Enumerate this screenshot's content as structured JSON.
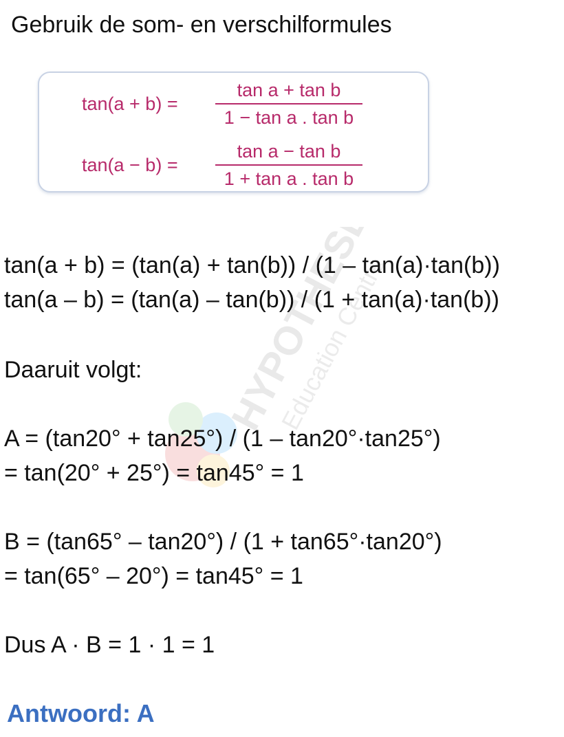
{
  "heading": "Gebruik de som- en verschilformules",
  "formula_box": {
    "row1": {
      "lhs": "tan(a + b) =",
      "numerator": "tan a + tan b",
      "denominator": "1 − tan a . tan b"
    },
    "row2": {
      "lhs": "tan(a − b) =",
      "numerator": "tan a − tan b",
      "denominator": "1 + tan a . tan b"
    },
    "color": "#b72a6a"
  },
  "lines": {
    "formula1": "tan(a + b) = (tan(a) + tan(b)) / (1 – tan(a)·tan(b))",
    "formula2": "tan(a – b) = (tan(a) – tan(b)) / (1 + tan(a)·tan(b))",
    "conclusion_intro": "Daaruit volgt:",
    "a_line1": "A = (tan20° + tan25°) / (1 – tan20°·tan25°)",
    "a_line2": "= tan(20° + 25°) = tan45° = 1",
    "b_line1": "B = (tan65° – tan20°) / (1 + tan65°·tan20°)",
    "b_line2": "= tan(65° – 20°) = tan45° = 1",
    "product": "Dus A · B = 1 · 1 = 1"
  },
  "answer": "Antwoord: A",
  "answer_color": "#3b6fc1",
  "watermark": {
    "brand": "HYPOTHESE",
    "tagline": "Education Centre"
  }
}
